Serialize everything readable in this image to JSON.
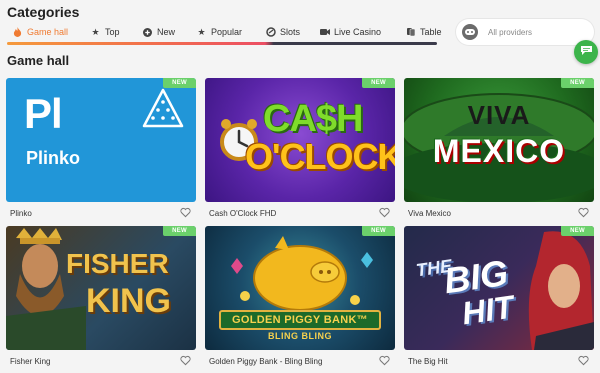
{
  "header": {
    "categories_title": "Categories",
    "providers_placeholder": "All providers",
    "chat_icon": "chat-bubble-icon"
  },
  "tabs": [
    {
      "label": "Game hall",
      "icon": "flame-icon",
      "active": true
    },
    {
      "label": "Top",
      "icon": "star-icon"
    },
    {
      "label": "New",
      "icon": "plus-icon"
    },
    {
      "label": "Popular",
      "icon": "star-icon"
    },
    {
      "label": "Slots",
      "icon": "slot-icon"
    },
    {
      "label": "Live Casino",
      "icon": "camera-icon"
    },
    {
      "label": "Table",
      "icon": "cards-icon"
    }
  ],
  "section": {
    "title": "Game hall"
  },
  "badge_label": "NEW",
  "colors": {
    "accent": "#f07b32",
    "badge": "#6bd06b",
    "background": "#f4f4f4",
    "chat": "#3cb44b"
  },
  "games": [
    {
      "name": "Plinko",
      "art": {
        "big": "Pl",
        "small": "Plinko"
      }
    },
    {
      "name": "Cash O'Clock FHD",
      "art": {
        "line1": "CA$H",
        "line2": "O'CLOCK"
      }
    },
    {
      "name": "Viva Mexico",
      "art": {
        "line1": "VIVA",
        "line2": "MEXICO"
      }
    },
    {
      "name": "Fisher King",
      "art": {
        "line1": "FISHER",
        "line2": "KING"
      }
    },
    {
      "name": "Golden Piggy Bank - Bling Bling",
      "art": {
        "line1": "GOLDEN PIGGY BANK™",
        "line2": "BLING BLING"
      }
    },
    {
      "name": "The Big Hit",
      "art": {
        "line1": "THE",
        "line2": "BIG",
        "line3": "HIT"
      }
    }
  ]
}
